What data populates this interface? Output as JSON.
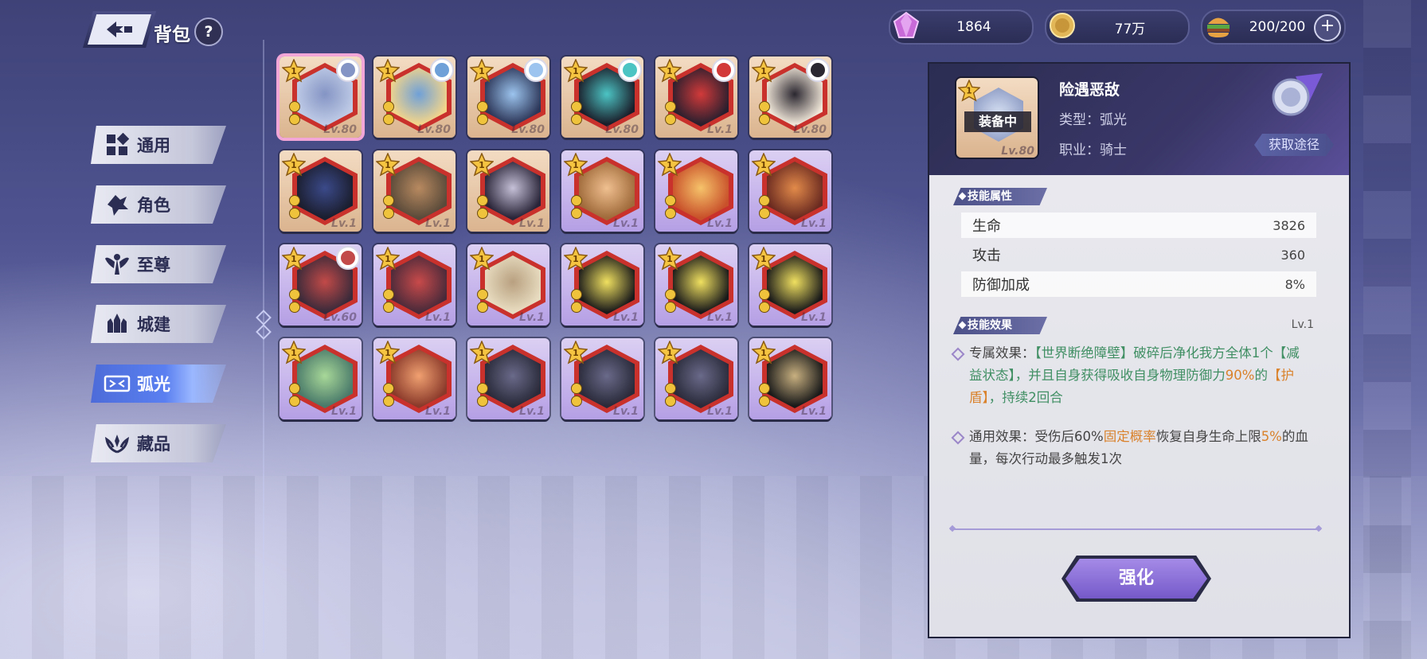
{
  "header": {
    "title": "背包",
    "help_label": "?"
  },
  "currency": {
    "gems": "1864",
    "gold": "77万",
    "stamina": "200/200"
  },
  "sidebar": {
    "tabs": [
      {
        "label": "通用",
        "icon": "grid-icon",
        "active": false
      },
      {
        "label": "角色",
        "icon": "character-icon",
        "active": false
      },
      {
        "label": "至尊",
        "icon": "wings-icon",
        "active": false
      },
      {
        "label": "城建",
        "icon": "castle-icon",
        "active": false
      },
      {
        "label": "弧光",
        "icon": "ticket-icon",
        "active": true
      },
      {
        "label": "藏品",
        "icon": "laurel-icon",
        "active": false
      }
    ]
  },
  "grid": {
    "items": [
      {
        "level": "Lv.80",
        "frame": "gold",
        "avatar": true,
        "stars": "1",
        "selected": true
      },
      {
        "level": "Lv.80",
        "frame": "gold",
        "avatar": true,
        "stars": "1"
      },
      {
        "level": "Lv.80",
        "frame": "gold",
        "avatar": true,
        "stars": "1"
      },
      {
        "level": "Lv.80",
        "frame": "gold",
        "avatar": true,
        "stars": "1"
      },
      {
        "level": "Lv.1",
        "frame": "gold",
        "avatar": true,
        "stars": "1"
      },
      {
        "level": "Lv.80",
        "frame": "gold",
        "avatar": true,
        "stars": "1"
      },
      {
        "level": "Lv.1",
        "frame": "gold",
        "avatar": false,
        "stars": "1"
      },
      {
        "level": "Lv.1",
        "frame": "gold",
        "avatar": false,
        "stars": "1"
      },
      {
        "level": "Lv.1",
        "frame": "gold",
        "avatar": false,
        "stars": "1"
      },
      {
        "level": "Lv.1",
        "frame": "purple",
        "avatar": false,
        "stars": "1"
      },
      {
        "level": "Lv.1",
        "frame": "purple",
        "avatar": false,
        "stars": "1"
      },
      {
        "level": "Lv.1",
        "frame": "purple",
        "avatar": false,
        "stars": "1"
      },
      {
        "level": "Lv.60",
        "frame": "purple",
        "avatar": true,
        "stars": "1"
      },
      {
        "level": "Lv.1",
        "frame": "purple",
        "avatar": false,
        "stars": "1"
      },
      {
        "level": "Lv.1",
        "frame": "purple",
        "avatar": false,
        "stars": "1"
      },
      {
        "level": "Lv.1",
        "frame": "purple",
        "avatar": false,
        "stars": "1"
      },
      {
        "level": "Lv.1",
        "frame": "purple",
        "avatar": false,
        "stars": "1"
      },
      {
        "level": "Lv.1",
        "frame": "purple",
        "avatar": false,
        "stars": "1"
      },
      {
        "level": "Lv.1",
        "frame": "purple",
        "avatar": false,
        "stars": "1"
      },
      {
        "level": "Lv.1",
        "frame": "purple",
        "avatar": false,
        "stars": "1"
      },
      {
        "level": "Lv.1",
        "frame": "purple",
        "avatar": false,
        "stars": "1"
      },
      {
        "level": "Lv.1",
        "frame": "purple",
        "avatar": false,
        "stars": "1"
      },
      {
        "level": "Lv.1",
        "frame": "purple",
        "avatar": false,
        "stars": "1"
      },
      {
        "level": "Lv.1",
        "frame": "purple",
        "avatar": false,
        "stars": "1"
      }
    ]
  },
  "detail": {
    "name": "险遇恶敌",
    "type": "类型：弧光",
    "class": "职业：骑士",
    "equipped_label": "装备中",
    "level": "Lv.80",
    "stars": "1",
    "obtain_label": "获取途径",
    "stats_title": "技能属性",
    "stats": [
      {
        "label": "生命",
        "value": "3826"
      },
      {
        "label": "攻击",
        "value": "360"
      },
      {
        "label": "防御加成",
        "value": "8%"
      }
    ],
    "effects_title": "技能效果",
    "effects_level": "Lv.1",
    "effect1": {
      "prefix": "专属效果：",
      "g1": "【世界断绝障壁】",
      "t1": "破碎后净化我方全体1个",
      "g2": "【减益状态】",
      "t2": "，并且自身获得吸收自身物理防御力",
      "o1": "90%",
      "t3": "的",
      "o2": "【护盾】",
      "t4": "，持续2回合"
    },
    "effect2": {
      "prefix": "通用效果：受伤后60%",
      "o1": "固定概率",
      "t1": "恢复自身生命上限",
      "o2": "5%",
      "t2": "的血量，每次行动最多触发1次"
    },
    "upgrade_label": "强化"
  },
  "colors": {
    "accent_purple": "#7559c9",
    "active_tab_blue": "#4d6cd9",
    "effect_green": "#3f8f63",
    "effect_orange": "#d9822b",
    "selected_pink": "#f2a5d7"
  }
}
